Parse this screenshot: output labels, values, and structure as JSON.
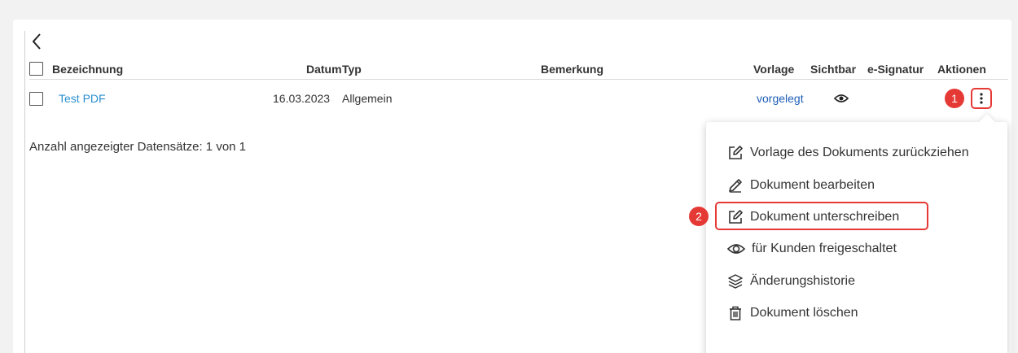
{
  "table": {
    "headers": {
      "bezeichnung": "Bezeichnung",
      "datum": "Datum",
      "typ": "Typ",
      "bemerkung": "Bemerkung",
      "vorlage": "Vorlage",
      "sichtbar": "Sichtbar",
      "esignatur": "e-Signatur",
      "aktionen": "Aktionen"
    },
    "rows": [
      {
        "bezeichnung": "Test PDF",
        "datum": "16.03.2023",
        "typ": "Allgemein",
        "bemerkung": "",
        "vorlage": "vorgelegt",
        "sichtbar_icon": "eye-icon"
      }
    ]
  },
  "record_count": "Anzahl angezeigter Datensätze: 1 von 1",
  "badges": {
    "actions": "1",
    "sign": "2"
  },
  "menu": {
    "items": [
      {
        "label": "Vorlage des Dokuments zurückziehen",
        "icon": "edit-icon"
      },
      {
        "label": "Dokument bearbeiten",
        "icon": "pencil-icon"
      },
      {
        "label": "Dokument unterschreiben",
        "icon": "edit-icon"
      },
      {
        "label": "für Kunden freigeschaltet",
        "icon": "eye-icon"
      },
      {
        "label": "Änderungshistorie",
        "icon": "layers-icon"
      },
      {
        "label": "Dokument löschen",
        "icon": "trash-icon"
      }
    ]
  },
  "colors": {
    "accent_red": "#e53935",
    "link": "#2a8fd0",
    "link_vorgelegt": "#1e5fb8"
  }
}
